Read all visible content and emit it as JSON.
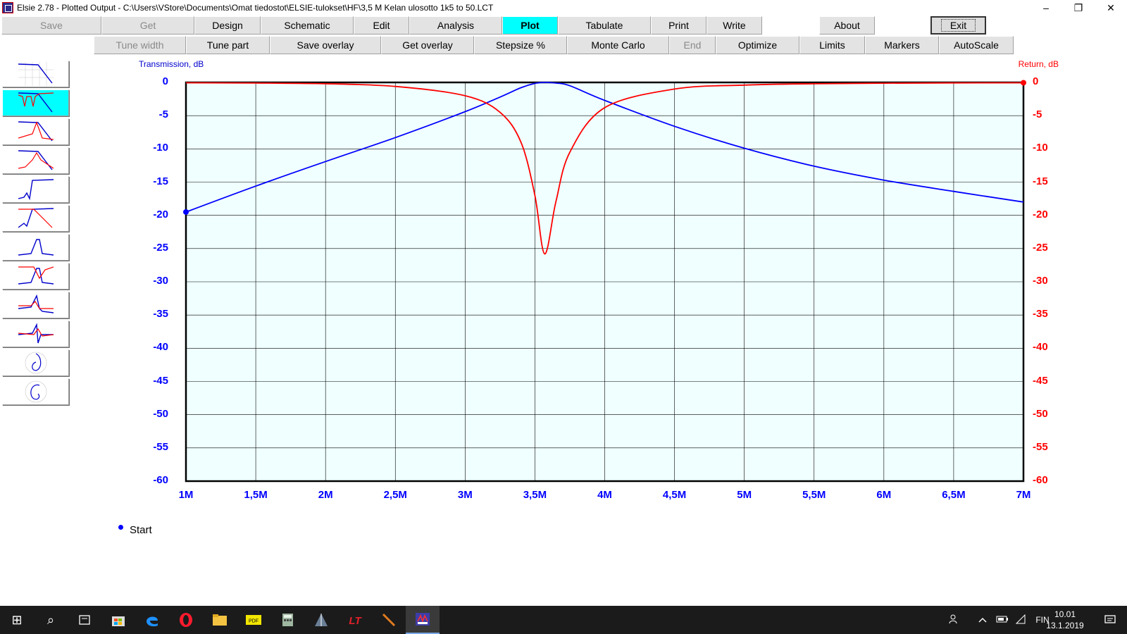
{
  "window": {
    "title": "Elsie 2.78 - Plotted Output - C:\\Users\\VStore\\Documents\\Omat tiedostot\\ELSIE-tulokset\\HF\\3,5 M Kelan ulosotto 1k5 to 50.LCT",
    "minimize_glyph": "–",
    "restore_glyph": "❐",
    "close_glyph": "✕"
  },
  "toolbar1": {
    "save": "Save",
    "get": "Get",
    "design": "Design",
    "schematic": "Schematic",
    "edit": "Edit",
    "analysis": "Analysis",
    "plot": "Plot",
    "tabulate": "Tabulate",
    "print": "Print",
    "write": "Write",
    "about": "About",
    "exit": "Exit"
  },
  "toolbar2": {
    "tune_width": "Tune width",
    "tune_part": "Tune part",
    "save_overlay": "Save overlay",
    "get_overlay": "Get overlay",
    "stepsize": "Stepsize %",
    "monte_carlo": "Monte Carlo",
    "end": "End",
    "optimize": "Optimize",
    "limits": "Limits",
    "markers": "Markers",
    "autoscale": "AutoScale"
  },
  "colors": {
    "transmission": "#0000ff",
    "return": "#ff0000",
    "plot_bg": "#f0ffff",
    "active_button": "#00ffff"
  },
  "chart_data": {
    "type": "line",
    "ylabel_left": "Transmission, dB",
    "ylabel_right": "Return, dB",
    "xlim": [
      "1M",
      "7M"
    ],
    "x_ticks": [
      "1M",
      "1,5M",
      "2M",
      "2,5M",
      "3M",
      "3,5M",
      "4M",
      "4,5M",
      "5M",
      "5,5M",
      "6M",
      "6,5M",
      "7M"
    ],
    "y_ticks_left": [
      "0",
      "-5",
      "-10",
      "-15",
      "-20",
      "-25",
      "-30",
      "-35",
      "-40",
      "-45",
      "-50",
      "-55",
      "-60"
    ],
    "y_ticks_right": [
      "0",
      "-5",
      "-10",
      "-15",
      "-20",
      "-25",
      "-30",
      "-35",
      "-40",
      "-45",
      "-50",
      "-55",
      "-60"
    ],
    "ylim": [
      -60,
      0
    ],
    "grid": true,
    "x_mhz": [
      1.0,
      1.5,
      2.0,
      2.5,
      3.0,
      3.25,
      3.4,
      3.5,
      3.57,
      3.65,
      3.75,
      4.0,
      4.5,
      5.0,
      5.5,
      6.0,
      6.5,
      7.0
    ],
    "series": [
      {
        "name": "Transmission, dB",
        "values": [
          -19.5,
          -15.6,
          -11.9,
          -8.3,
          -4.4,
          -2.2,
          -0.8,
          -0.15,
          0.0,
          -0.1,
          -0.5,
          -2.7,
          -6.6,
          -9.9,
          -12.6,
          -14.7,
          -16.4,
          -18.0
        ]
      },
      {
        "name": "Return, dB",
        "values": [
          -0.05,
          -0.1,
          -0.2,
          -0.6,
          -2.0,
          -4.5,
          -9.0,
          -17.0,
          -25.8,
          -18.0,
          -10.5,
          -3.8,
          -1.0,
          -0.4,
          -0.2,
          -0.12,
          -0.07,
          -0.05
        ]
      }
    ]
  },
  "legend": {
    "start_label": "Start"
  },
  "taskbar": {
    "start_glyph": "⊞",
    "search_glyph": "⌕",
    "tray_lang": "FIN",
    "clock_time": "10.01",
    "clock_date": "13.1.2019"
  }
}
